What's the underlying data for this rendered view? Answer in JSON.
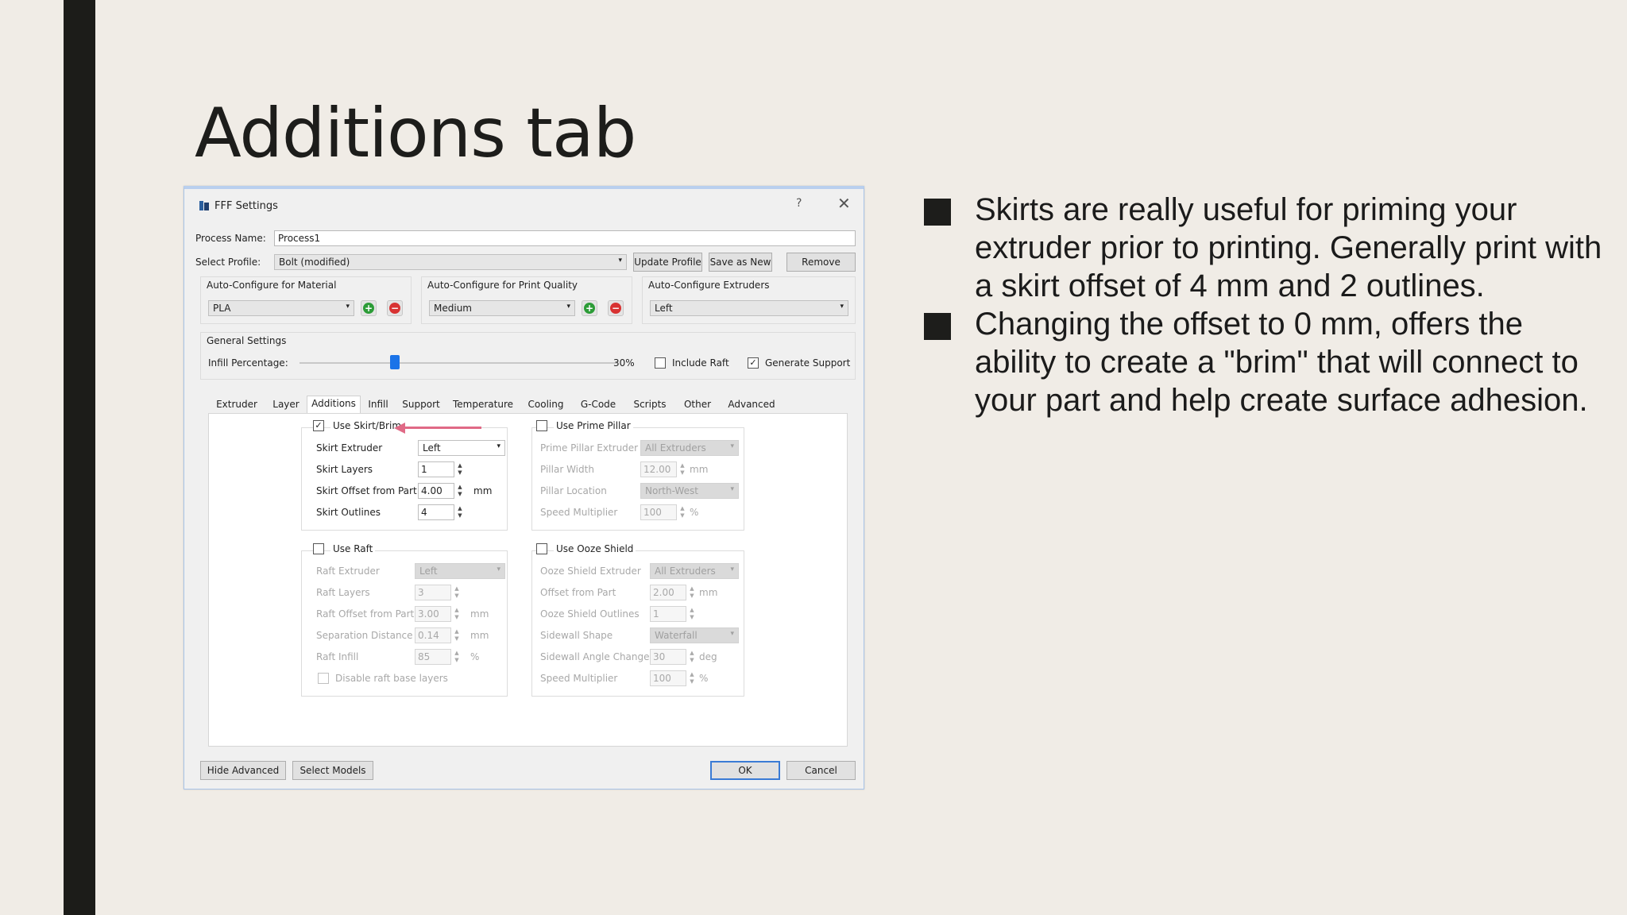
{
  "slide": {
    "title": "Additions tab",
    "bullets": [
      "Skirts are really useful for priming your extruder prior to printing. Generally print with a skirt offset of 4 mm and 2 outlines.",
      "Changing the offset to 0 mm, offers the ability to create a \"brim\" that will connect to your part and help create surface adhesion."
    ]
  },
  "dialog": {
    "title": "FFF Settings",
    "help": "?",
    "close": "✕",
    "process_name_label": "Process Name:",
    "process_name_value": "Process1",
    "select_profile_label": "Select Profile:",
    "select_profile_value": "Bolt (modified)",
    "update_profile": "Update Profile",
    "save_as_new": "Save as New",
    "remove": "Remove",
    "auto_material_label": "Auto-Configure for Material",
    "auto_material_value": "PLA",
    "auto_quality_label": "Auto-Configure for Print Quality",
    "auto_quality_value": "Medium",
    "auto_extruders_label": "Auto-Configure Extruders",
    "auto_extruders_value": "Left",
    "general_settings_label": "General Settings",
    "infill_label": "Infill Percentage:",
    "infill_value": "30%",
    "infill_fraction": 0.3,
    "include_raft": "Include Raft",
    "generate_support": "Generate Support",
    "tabs": [
      "Extruder",
      "Layer",
      "Additions",
      "Infill",
      "Support",
      "Temperature",
      "Cooling",
      "G-Code",
      "Scripts",
      "Other",
      "Advanced"
    ],
    "skirt": {
      "checkbox": "Use Skirt/Brim",
      "extruder_label": "Skirt Extruder",
      "extruder_value": "Left",
      "layers_label": "Skirt Layers",
      "layers_value": "1",
      "offset_label": "Skirt Offset from Part",
      "offset_value": "4.00",
      "offset_unit": "mm",
      "outlines_label": "Skirt Outlines",
      "outlines_value": "4"
    },
    "prime": {
      "checkbox": "Use Prime Pillar",
      "extruder_label": "Prime Pillar Extruder",
      "extruder_value": "All Extruders",
      "width_label": "Pillar Width",
      "width_value": "12.00",
      "width_unit": "mm",
      "location_label": "Pillar Location",
      "location_value": "North-West",
      "speed_label": "Speed Multiplier",
      "speed_value": "100",
      "speed_unit": "%"
    },
    "raft": {
      "checkbox": "Use Raft",
      "extruder_label": "Raft Extruder",
      "extruder_value": "Left",
      "layers_label": "Raft Layers",
      "layers_value": "3",
      "offset_label": "Raft Offset from Part",
      "offset_value": "3.00",
      "offset_unit": "mm",
      "separation_label": "Separation Distance",
      "separation_value": "0.14",
      "separation_unit": "mm",
      "infill_label": "Raft Infill",
      "infill_value": "85",
      "infill_unit": "%",
      "disable_base": "Disable raft base layers"
    },
    "ooze": {
      "checkbox": "Use Ooze Shield",
      "extruder_label": "Ooze Shield Extruder",
      "extruder_value": "All Extruders",
      "offset_label": "Offset from Part",
      "offset_value": "2.00",
      "offset_unit": "mm",
      "outlines_label": "Ooze Shield Outlines",
      "outlines_value": "1",
      "sidewall_label": "Sidewall Shape",
      "sidewall_value": "Waterfall",
      "angle_label": "Sidewall Angle Change",
      "angle_value": "30",
      "angle_unit": "deg",
      "speed_label": "Speed Multiplier",
      "speed_value": "100",
      "speed_unit": "%"
    },
    "hide_advanced": "Hide Advanced",
    "select_models": "Select Models",
    "ok": "OK",
    "cancel": "Cancel"
  },
  "colors": {
    "background": "#f0ece6",
    "accent_bar": "#1c1c19",
    "annotation_arrow": "#e06a86",
    "slider_thumb": "#1a73e8"
  }
}
